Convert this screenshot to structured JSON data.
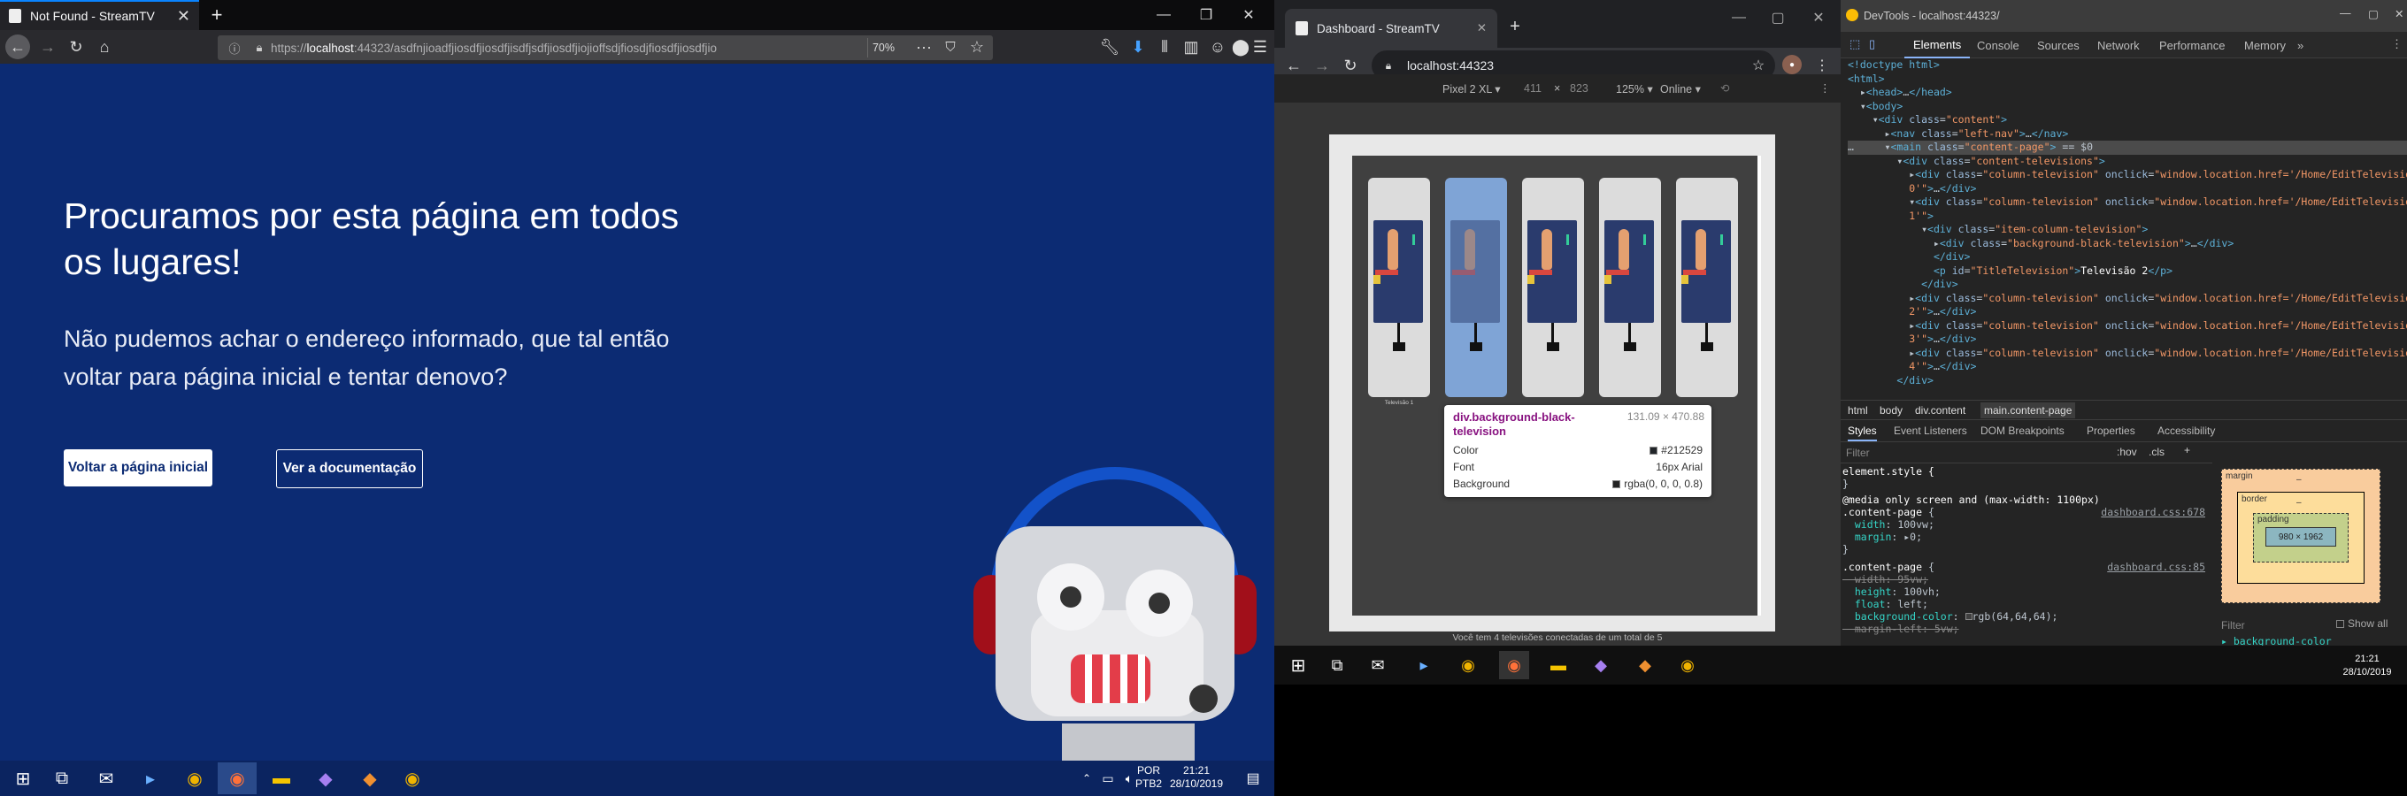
{
  "left_window": {
    "tab_title": "Not Found - StreamTV",
    "url_prefix": "https://",
    "url_host": "localhost",
    "url_rest": ":44323/asdfnjioadfjiosdfjiosdfjisdfjsdfjiosdfjiojioffsdjfiosdjfiosdfjiosdfjio",
    "zoom": "70%",
    "heading": "Procuramos por esta página em todos os lugares!",
    "paragraph": "Não pudemos achar o endereço informado, que tal então voltar para página inicial e tentar denovo?",
    "btn_home": "Voltar a página inicial",
    "btn_docs": "Ver a documentação",
    "bg_color": "#0c2b73"
  },
  "taskbar_left": {
    "lang": "POR",
    "layout": "PTB2",
    "time": "21:21",
    "date": "28/10/2019"
  },
  "chrome_window": {
    "tab_title": "Dashboard - StreamTV",
    "url": "localhost:44323",
    "device": "Pixel 2 XL ▾",
    "width": "411",
    "times": "×",
    "height": "823",
    "zoom": "125% ▾",
    "network": "Online ▾",
    "tv_label": "Televisão 1",
    "tooltip": {
      "selector": "div.background-black-television",
      "size": "131.09 × 470.88",
      "color_label": "Color",
      "color_value": "#212529",
      "font_label": "Font",
      "font_value": "16px Arial",
      "bg_label": "Background",
      "bg_value": "rgba(0, 0, 0, 0.8)"
    },
    "footer_note": "Você tem 4 televisões conectadas de um total de 5"
  },
  "devtools": {
    "title": "DevTools - localhost:44323/",
    "tabs": [
      "Elements",
      "Console",
      "Sources",
      "Network",
      "Performance",
      "Memory",
      "»"
    ],
    "breadcrumbs": [
      "html",
      "body",
      "div.content",
      "main.content-page"
    ],
    "style_tabs": [
      "Styles",
      "Event Listeners",
      "DOM Breakpoints",
      "Properties",
      "Accessibility"
    ],
    "filter_placeholder": "Filter",
    "hov": ":hov",
    "cls": ".cls",
    "box": {
      "margin": "margin",
      "border": "border",
      "padding": "padding",
      "content": "980 × 1962",
      "dash": "–"
    },
    "filter2": "Filter",
    "show_all": "Show all",
    "bg_color_prop": "background-color",
    "media_rule": "@media only screen and (max-width: 1100px)",
    "css_src1": "dashboard.css:678",
    "css_src2": "dashboard.css:85",
    "element_style": "element.style {",
    "close_brace": "}",
    "dollar0": "== $0"
  },
  "taskbar_right": {
    "time": "21:21",
    "date": "28/10/2019"
  }
}
